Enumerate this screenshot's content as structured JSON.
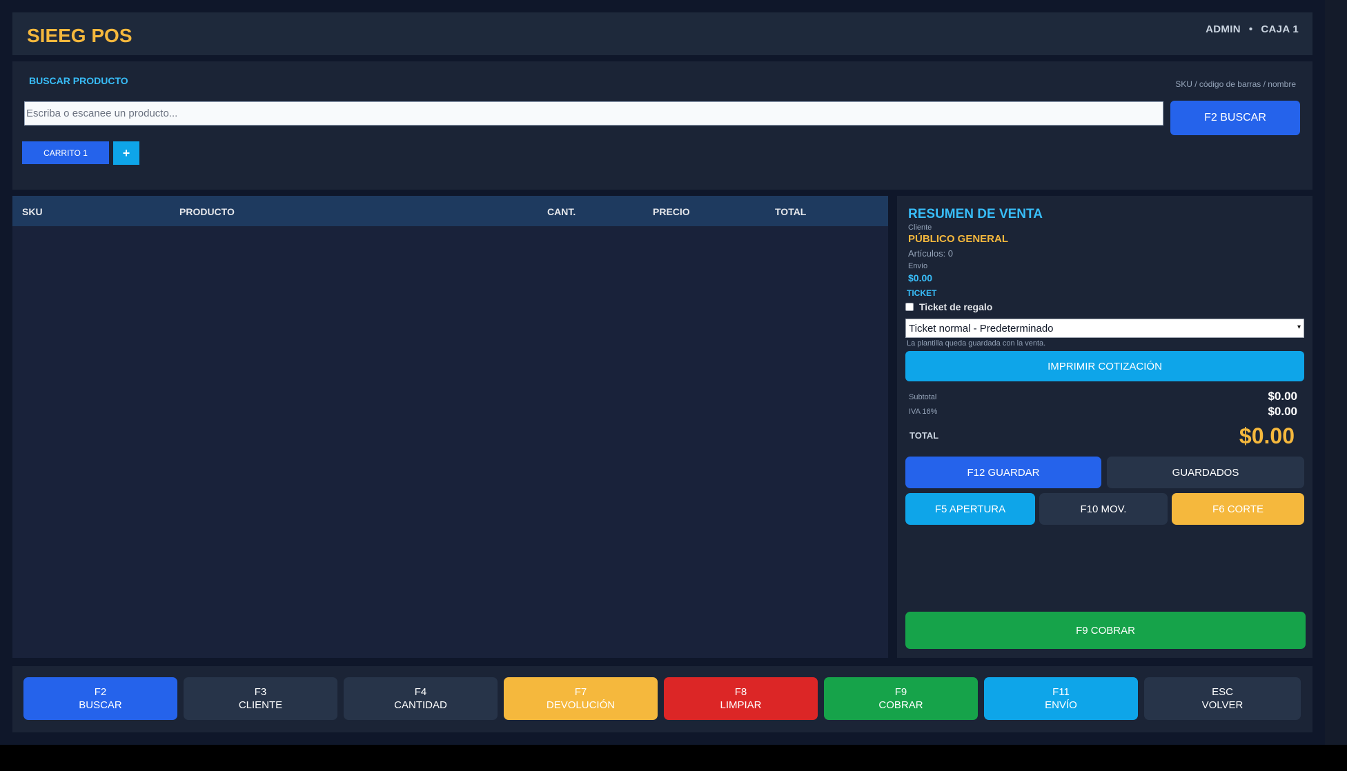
{
  "colors": {
    "primary": "#2563eb",
    "info": "#0ea5e9",
    "warning": "#f5b83d",
    "danger": "#dc2626",
    "success": "#16a34a",
    "neutral": "#273449",
    "accent_text": "#38bdf8"
  },
  "header": {
    "brand": "SIEEG POS",
    "user": "ADMIN",
    "separator": "•",
    "register": "CAJA 1"
  },
  "search": {
    "title": "BUSCAR PRODUCTO",
    "hint": "SKU / código de barras / nombre",
    "placeholder": "Escriba o escanee un producto...",
    "button_label": "F2  BUSCAR"
  },
  "carts": {
    "tabs": [
      "CARRITO 1"
    ],
    "add_label": "+"
  },
  "table": {
    "columns": [
      "SKU",
      "PRODUCTO",
      "CANT.",
      "PRECIO",
      "TOTAL"
    ],
    "rows": []
  },
  "summary": {
    "title": "RESUMEN DE VENTA",
    "client_label": "Cliente",
    "client_name": "PÚBLICO GENERAL",
    "articles": "Artículos: 0",
    "shipping_label": "Envío",
    "shipping_value": "$0.00",
    "ticket_label": "TICKET",
    "gift_label": "Ticket de regalo",
    "gift_checked": false,
    "template_value": "Ticket normal - Predeterminado",
    "template_note": "La plantilla queda guardada con la venta.",
    "quote_button": "IMPRIMIR COTIZACIÓN",
    "subtotal_label": "Subtotal",
    "subtotal_value": "$0.00",
    "iva_label": "IVA 16%",
    "iva_value": "$0.00",
    "total_label": "TOTAL",
    "total_value": "$0.00",
    "save_button": "F12  GUARDAR",
    "saved_button": "GUARDADOS",
    "open_button": "F5 APERTURA",
    "mov_button": "F10 MOV.",
    "cut_button": "F6 CORTE",
    "charge_button": "F9   COBRAR"
  },
  "fkeys": [
    {
      "key": "F2",
      "label": "BUSCAR",
      "color": "primary"
    },
    {
      "key": "F3",
      "label": "CLIENTE",
      "color": "neutral"
    },
    {
      "key": "F4",
      "label": "CANTIDAD",
      "color": "neutral"
    },
    {
      "key": "F7",
      "label": "DEVOLUCIÓN",
      "color": "warning"
    },
    {
      "key": "F8",
      "label": "LIMPIAR",
      "color": "danger"
    },
    {
      "key": "F9",
      "label": "COBRAR",
      "color": "success"
    },
    {
      "key": "F11",
      "label": "ENVÍO",
      "color": "info"
    },
    {
      "key": "ESC",
      "label": "VOLVER",
      "color": "neutral"
    }
  ]
}
